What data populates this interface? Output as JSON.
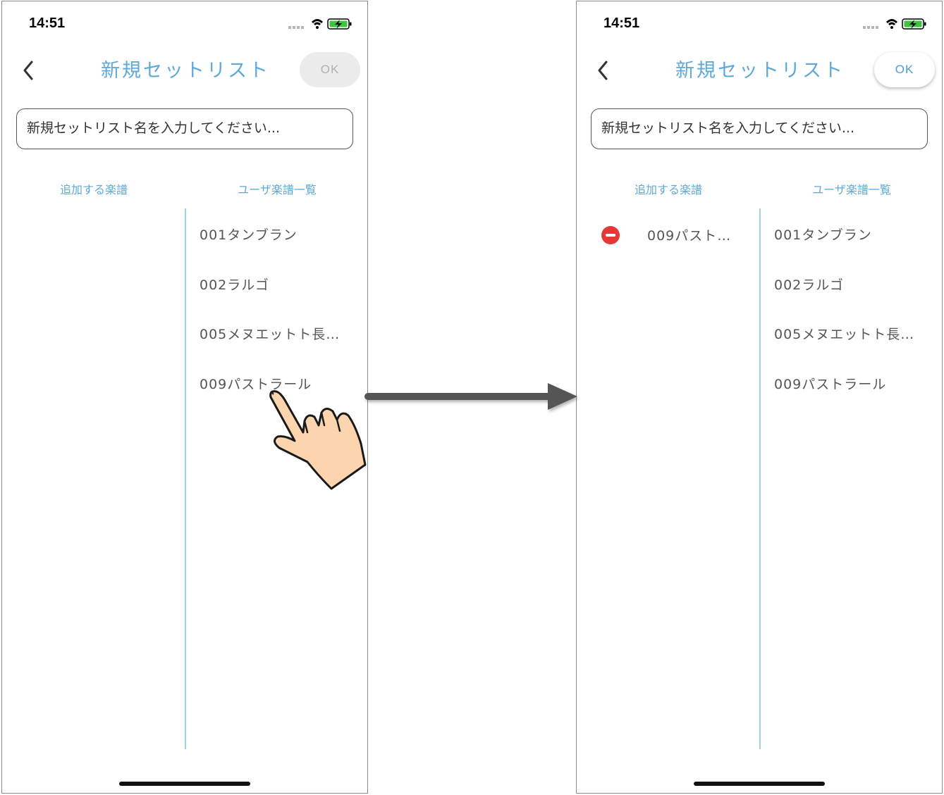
{
  "left_screen": {
    "status": {
      "time": "14:51"
    },
    "nav": {
      "title": "新規セットリスト",
      "ok_label": "OK"
    },
    "name_input": {
      "placeholder": "新規セットリスト名を入力してください..."
    },
    "columns": {
      "added_header": "追加する楽譜",
      "library_header": "ユーザ楽譜一覧"
    },
    "added_songs": [],
    "library_songs": [
      "001タンブラン",
      "002ラルゴ",
      "005メヌエットト長…",
      "009パストラール"
    ]
  },
  "right_screen": {
    "status": {
      "time": "14:51"
    },
    "nav": {
      "title": "新規セットリスト",
      "ok_label": "OK"
    },
    "name_input": {
      "placeholder": "新規セットリスト名を入力してください..."
    },
    "columns": {
      "added_header": "追加する楽譜",
      "library_header": "ユーザ楽譜一覧"
    },
    "added_songs": [
      "009パスト…"
    ],
    "library_songs": [
      "001タンブラン",
      "002ラルゴ",
      "005メヌエットト長…",
      "009パストラール"
    ]
  },
  "colors": {
    "accent": "#5fa9d8",
    "ok_enabled": "#4a9fd9",
    "ok_disabled_bg": "#ececec",
    "remove_icon": "#e53935",
    "arrow": "#555555",
    "hand_fill": "#fcd4ad"
  },
  "icons": {
    "back": "chevron-left-icon",
    "remove": "minus-circle-icon",
    "signal": "signal-icon",
    "wifi": "wifi-icon",
    "battery": "battery-charging-icon",
    "tap": "pointing-hand-icon",
    "transition": "arrow-right-icon"
  }
}
